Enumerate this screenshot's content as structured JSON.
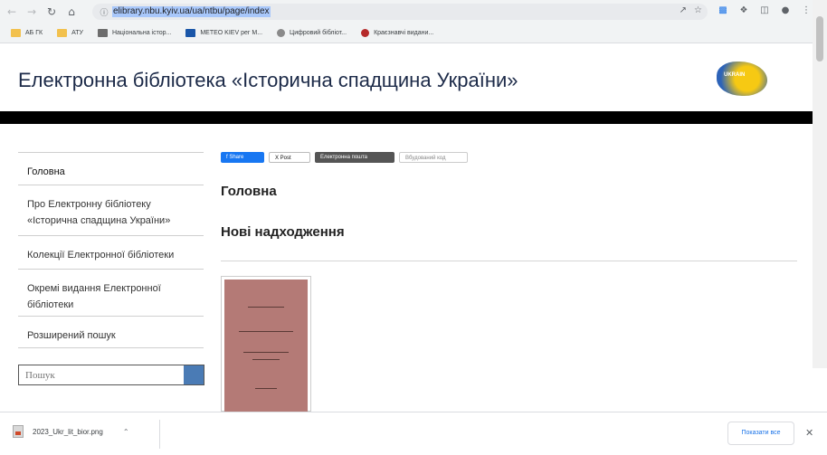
{
  "browser": {
    "url": "elibrary.nbu.kyiv.ua/ua/ntbu/page/index",
    "bookmarks": [
      {
        "label": "АБ ГК",
        "icon": "folder-icon"
      },
      {
        "label": "АТУ",
        "icon": "folder-icon"
      },
      {
        "label": "Національна істор...",
        "icon": "document-icon"
      },
      {
        "label": "METEO KIEV рег М...",
        "icon": "meteo-icon"
      },
      {
        "label": "Цифровий бібліот...",
        "icon": "globe-icon"
      },
      {
        "label": "Краєзнавчі видани...",
        "icon": "red-circle-icon"
      }
    ]
  },
  "site": {
    "title": "Електронна бібліотека «Історична спадщина України»",
    "logo_text": "UKRAIN"
  },
  "sidebar": {
    "items": [
      {
        "label": "Головна"
      },
      {
        "label": "Про Електронну бібліотеку «Історична спадщина України»"
      },
      {
        "label": "Колекції Електронної бібліотеки"
      },
      {
        "label": "Окремі видання Електронної бібліотеки"
      },
      {
        "label": "Розширений пошук"
      }
    ],
    "search_placeholder": "Пошук"
  },
  "share": {
    "facebook": "f Share",
    "x": "X Post",
    "email": "Електронна пошта",
    "embed": "Вбудований код"
  },
  "main": {
    "heading": "Головна",
    "section_heading": "Нові надходження"
  },
  "downloads": {
    "file_name": "2023_Ukr_lit_bior.png",
    "show_all": "Показати все"
  }
}
